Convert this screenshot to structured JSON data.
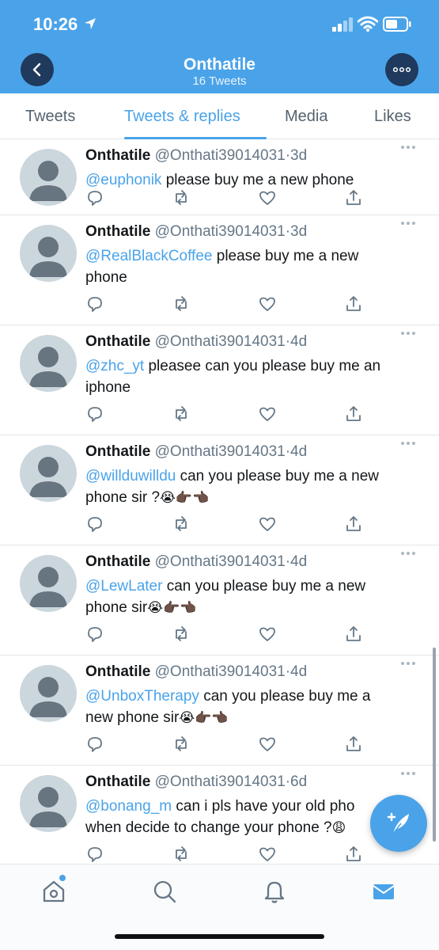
{
  "status_bar": {
    "time": "10:26"
  },
  "header": {
    "title": "Onthatile",
    "subtitle": "16 Tweets"
  },
  "tabs": [
    {
      "label": "Tweets",
      "active": false
    },
    {
      "label": "Tweets & replies",
      "active": true
    },
    {
      "label": "Media",
      "active": false
    },
    {
      "label": "Likes",
      "active": false
    }
  ],
  "tweets": [
    {
      "name": "Onthatile",
      "handle": "@Onthati39014031",
      "time": "3d",
      "mention": "@euphonik",
      "line1": " please buy me a new phone",
      "line2": "",
      "emoji": ""
    },
    {
      "name": "Onthatile",
      "handle": "@Onthati39014031",
      "time": "3d",
      "mention": "@RealBlackCoffee",
      "line1": " please buy me a new",
      "line2": "phone",
      "emoji": ""
    },
    {
      "name": "Onthatile",
      "handle": "@Onthati39014031",
      "time": "4d",
      "mention": "@zhc_yt",
      "line1": " pleasee can you please buy me an",
      "line2": "iphone",
      "emoji": ""
    },
    {
      "name": "Onthatile",
      "handle": "@Onthati39014031",
      "time": "4d",
      "mention": "@willduwilldu",
      "line1": " can you please buy me a new",
      "line2": "phone sir ?",
      "emoji": "😭👉🏿👈🏿"
    },
    {
      "name": "Onthatile",
      "handle": "@Onthati39014031",
      "time": "4d",
      "mention": "@LewLater",
      "line1": " can you please buy me a new",
      "line2": "phone sir",
      "emoji": "😭👉🏿👈🏿"
    },
    {
      "name": "Onthatile",
      "handle": "@Onthati39014031",
      "time": "4d",
      "mention": "@UnboxTherapy",
      "line1": " can you please buy me a",
      "line2": "new phone sir",
      "emoji": "😭👉🏿👈🏿"
    },
    {
      "name": "Onthatile",
      "handle": "@Onthati39014031",
      "time": "6d",
      "mention": "@bonang_m",
      "line1": " can i pls have your old pho",
      "line2": "when decide to change your phone ?",
      "emoji": "😩"
    }
  ],
  "separator": "·",
  "icons": {
    "back": "chevron-left-icon",
    "more": "more-horizontal-icon",
    "reply": "reply-icon",
    "retweet": "retweet-icon",
    "like": "heart-icon",
    "share": "share-icon",
    "compose": "compose-tweet-icon",
    "home": "home-icon",
    "search": "search-icon",
    "notifications": "bell-icon",
    "messages": "mail-icon"
  },
  "colors": {
    "brand": "#4aa3e9",
    "header_button": "#1f3a5c",
    "text": "#14171a",
    "muted": "#657786"
  }
}
